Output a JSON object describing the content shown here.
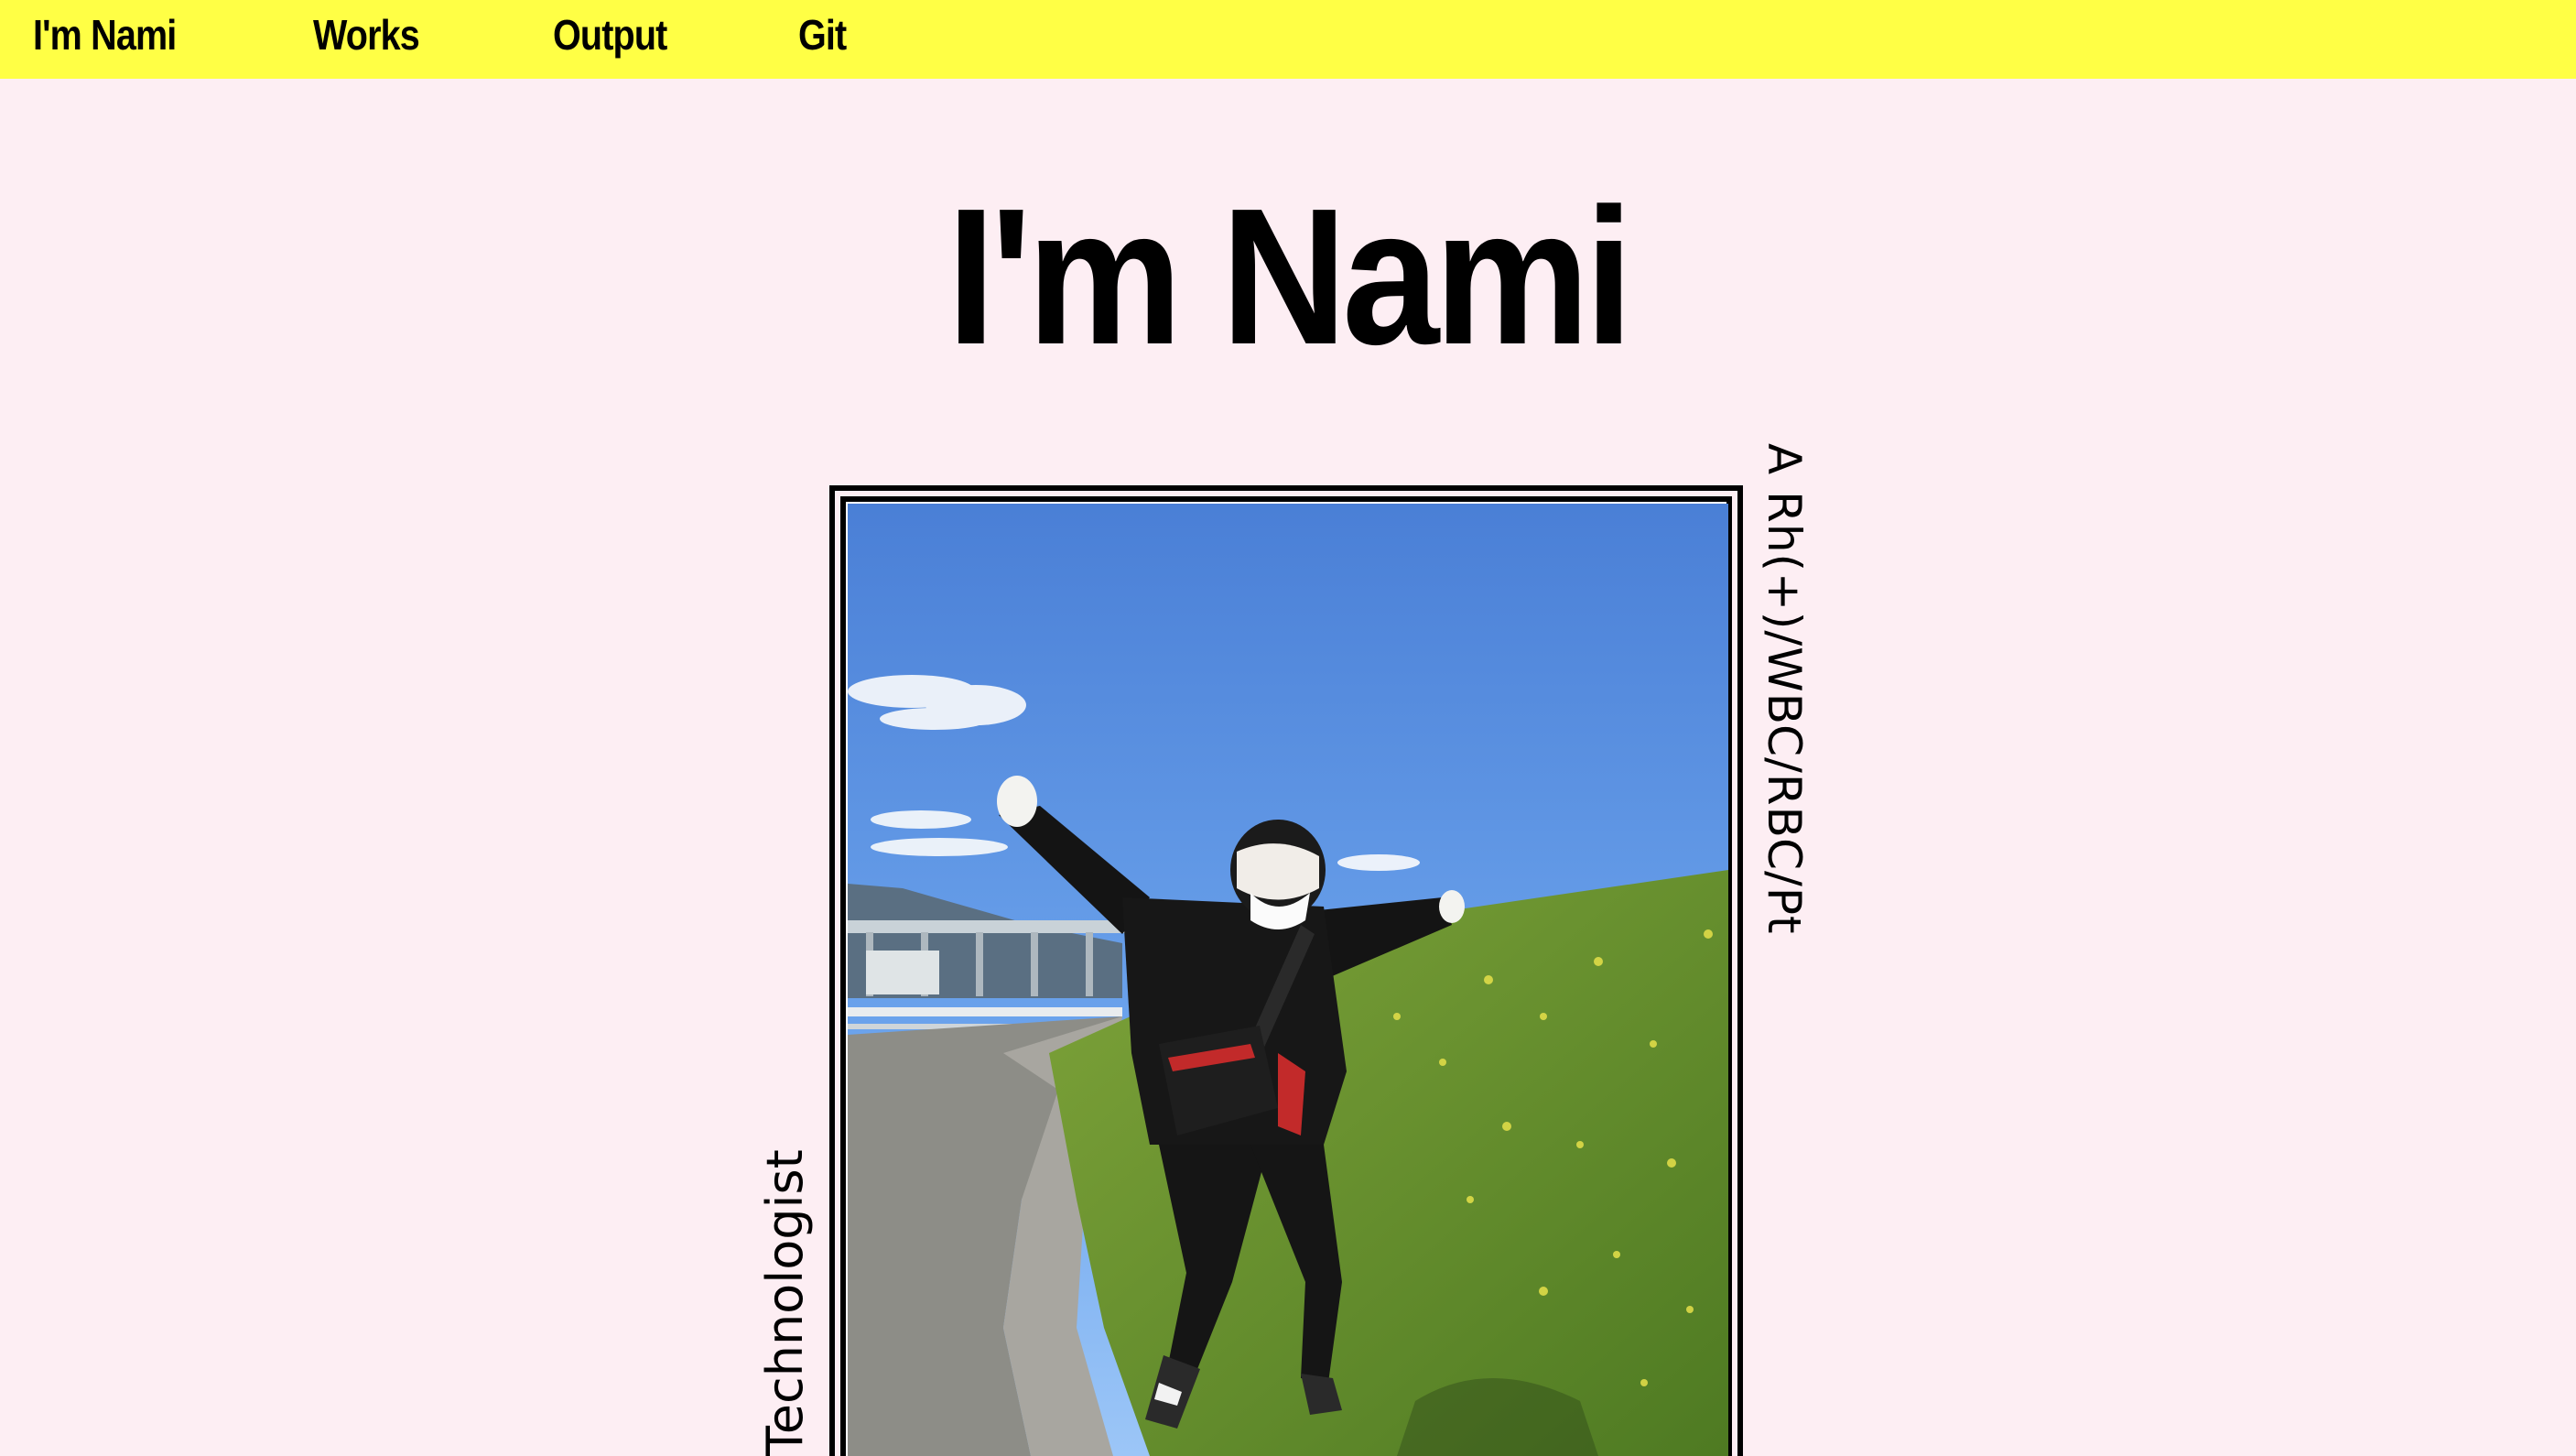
{
  "nav": {
    "items": [
      {
        "label": "I'm Nami"
      },
      {
        "label": "Works"
      },
      {
        "label": "Output"
      },
      {
        "label": "Git"
      }
    ]
  },
  "hero": {
    "title": "I'm Nami",
    "tagline_right": "A Rh(+)/WBC/RBC/Pt",
    "tagline_left": "Technologist"
  },
  "colors": {
    "nav_background": "#ffff45",
    "page_background": "#fdeef3",
    "text": "#000000"
  }
}
